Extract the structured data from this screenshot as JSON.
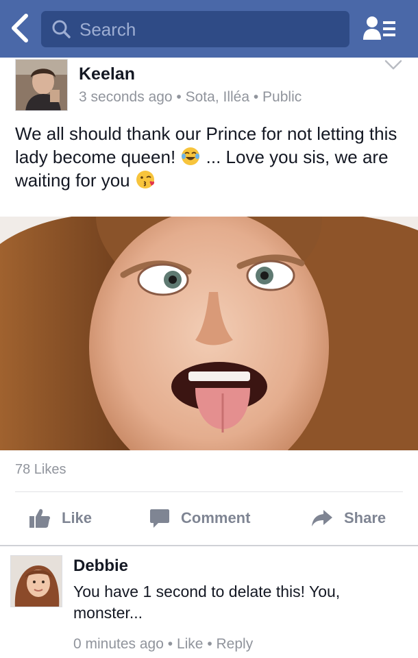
{
  "navbar": {
    "search_placeholder": "Search",
    "background_color": "#4a68a8",
    "search_field_color": "#2f4b86",
    "icons": [
      "back-chevron-icon",
      "search-icon",
      "friend-requests-icon"
    ]
  },
  "post": {
    "author": "Keelan",
    "meta": "3 seconds ago • Sota, Illéa • Public",
    "text_line1": "We all should thank our Prince for not letting this lady become queen!",
    "text_line2": "... Love you sis, we are waiting for you",
    "emoji_1": "tears-of-joy-emoji",
    "emoji_2": "kiss-emoji",
    "likes": "78 Likes",
    "actions": {
      "like": "Like",
      "comment": "Comment",
      "share": "Share"
    }
  },
  "comment": {
    "author": "Debbie",
    "text": "You have 1 second to delate this! You, monster...",
    "meta_time": "0 minutes ago",
    "meta_like": "Like",
    "meta_reply": "Reply"
  }
}
